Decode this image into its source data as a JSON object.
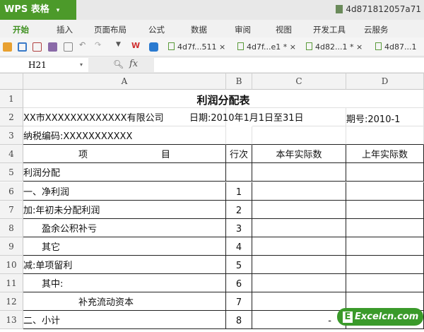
{
  "app": {
    "logo": "WPS 表格",
    "doc_title": "4d871812057a71"
  },
  "menu": [
    "开始",
    "插入",
    "页面布局",
    "公式",
    "数据",
    "审阅",
    "视图",
    "开发工具",
    "云服务"
  ],
  "doc_tabs": [
    "4d7f...511 ×",
    "4d7f...e1 * ×",
    "4d82...1 * ×",
    "4d87...1"
  ],
  "formula": {
    "name_box": "H21",
    "fx": "fx",
    "value": ""
  },
  "columns": [
    "A",
    "B",
    "C",
    "D"
  ],
  "rows": [
    "1",
    "2",
    "3",
    "4",
    "5",
    "6",
    "7",
    "8",
    "9",
    "10",
    "11",
    "12",
    "13"
  ],
  "sheet": {
    "title": "利润分配表",
    "company": "XX市XXXXXXXXXXXXX有限公司",
    "date": "日期:2010年1月1日至31日",
    "period": "期号:2010-1",
    "tax_id": "纳税编码:XXXXXXXXXXX",
    "header": {
      "item_left": "项",
      "item_right": "目",
      "seq": "行次",
      "this_year": "本年实际数",
      "last_year": "上年实际数"
    },
    "items": [
      {
        "label": "利润分配",
        "seq": ""
      },
      {
        "label": "一、净利润",
        "seq": "1"
      },
      {
        "label": "加:年初未分配利润",
        "seq": "2"
      },
      {
        "label": "　　盈余公积补亏",
        "seq": "3"
      },
      {
        "label": "　　其它",
        "seq": "4"
      },
      {
        "label": "减:单项留利",
        "seq": "5"
      },
      {
        "label": "　　其中:",
        "seq": "6"
      },
      {
        "label": "　　　　　　补充流动资本",
        "seq": "7"
      },
      {
        "label": "二、小计",
        "seq": "8",
        "this_year": "-"
      }
    ]
  },
  "watermark": "Excelcn.com"
}
